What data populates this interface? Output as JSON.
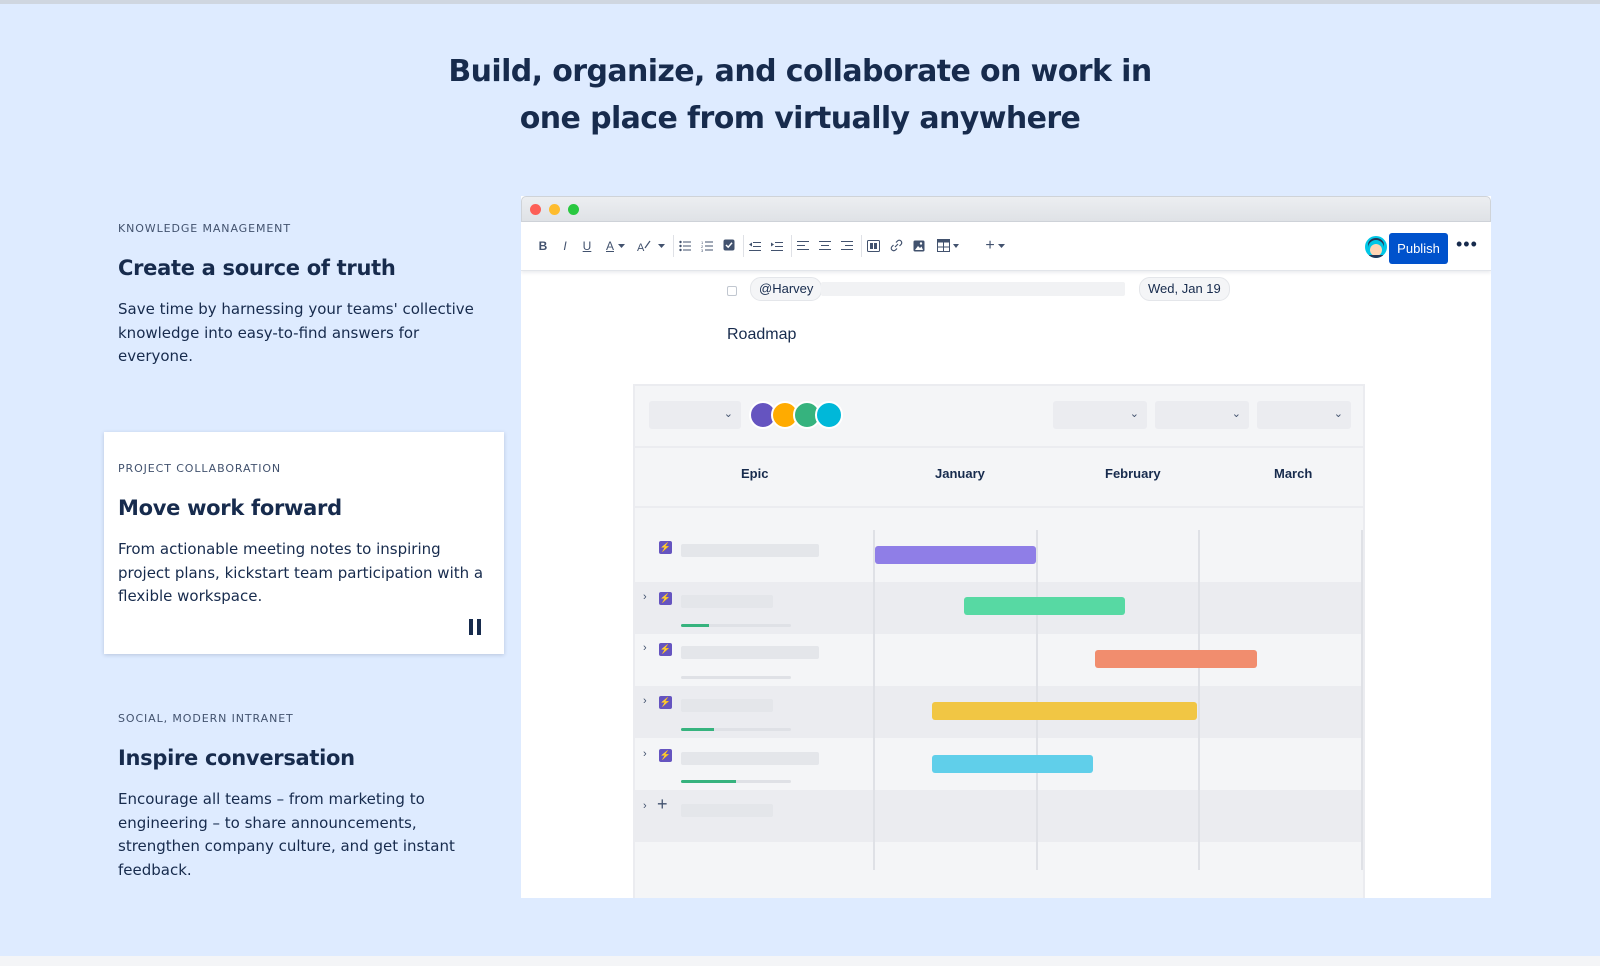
{
  "headline": {
    "line1": "Build, organize, and collaborate on work in",
    "line2": "one place from virtually anywhere"
  },
  "features": [
    {
      "eyebrow": "KNOWLEDGE MANAGEMENT",
      "title": "Create a source of truth",
      "body": "Save time by harnessing your teams' collective knowledge into easy-to-find answers for everyone."
    },
    {
      "eyebrow": "PROJECT COLLABORATION",
      "title": "Move work forward",
      "body": "From actionable meeting notes to inspiring project plans, kickstart team participation with a flexible workspace."
    },
    {
      "eyebrow": "SOCIAL, MODERN INTRANET",
      "title": "Inspire conversation",
      "body": "Encourage all teams – from marketing to engineering – to share announcements, strengthen company culture, and get instant feedback."
    }
  ],
  "editor": {
    "toolbar": {
      "bold": "B",
      "italic": "I",
      "underline": "U",
      "text_color": "A",
      "insert": "+",
      "publish": "Publish",
      "more": "•••"
    },
    "mention": "@Harvey",
    "date": "Wed, Jan 19",
    "roadmap_title": "Roadmap"
  },
  "roadmap": {
    "columns": {
      "epic": "Epic",
      "month1": "January",
      "month2": "February",
      "month3": "March"
    },
    "colors": {
      "purple": "#8f7ee7",
      "green": "#57d9a3",
      "red": "#f18d6e",
      "yellow": "#f1c644",
      "blue": "#60cfea"
    },
    "progress": [
      0.25,
      0,
      0.3,
      0.5
    ]
  }
}
